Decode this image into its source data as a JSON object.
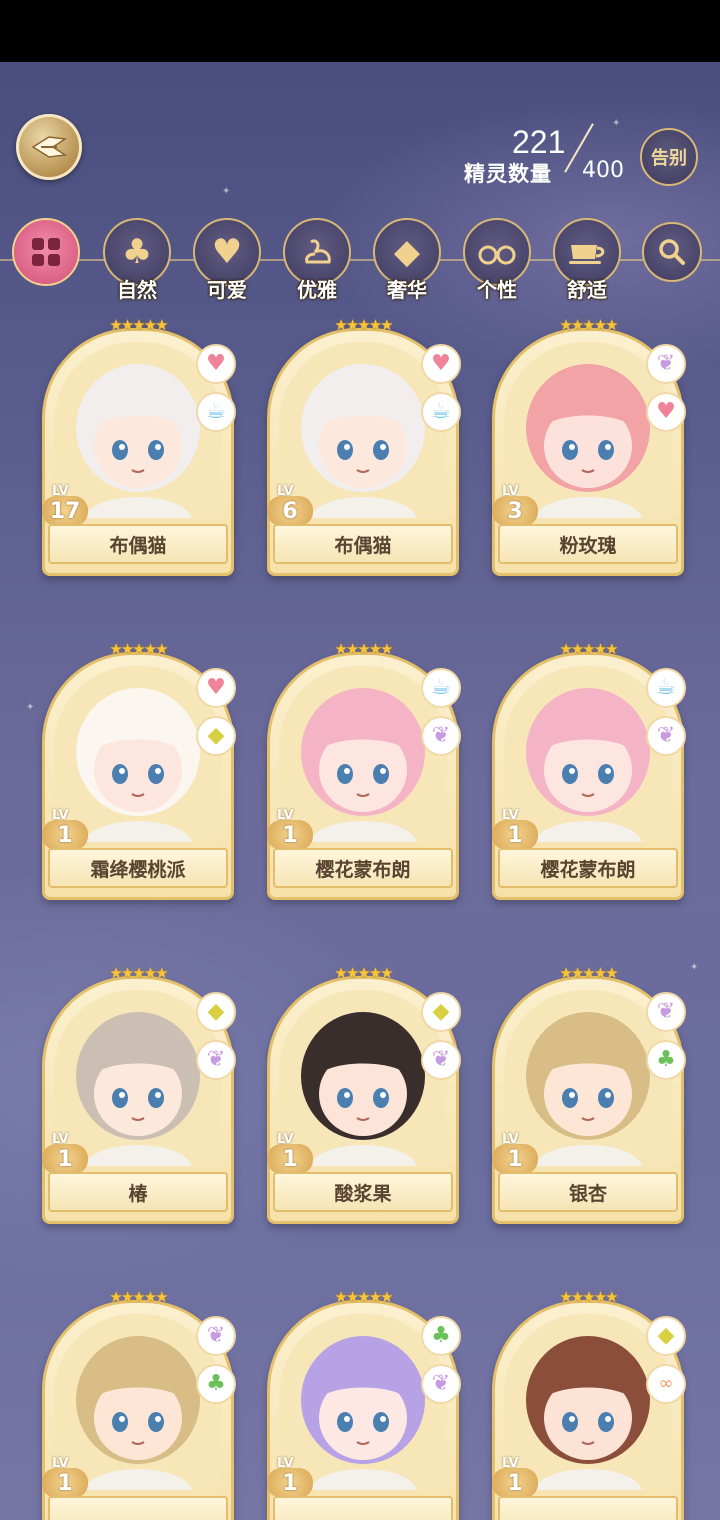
{
  "header": {
    "count_current": "221",
    "count_label": "精灵数量",
    "count_max": "400",
    "farewell_label": "告别"
  },
  "filters": [
    {
      "id": "all",
      "label": "",
      "icon": "grid-icon"
    },
    {
      "id": "natural",
      "label": "自然",
      "icon": "clover-icon"
    },
    {
      "id": "cute",
      "label": "可爱",
      "icon": "heart-icon"
    },
    {
      "id": "elegant",
      "label": "优雅",
      "icon": "swan-icon"
    },
    {
      "id": "luxury",
      "label": "奢华",
      "icon": "gem-icon"
    },
    {
      "id": "personality",
      "label": "个性",
      "icon": "glasses-icon"
    },
    {
      "id": "comfort",
      "label": "舒适",
      "icon": "teacup-icon"
    },
    {
      "id": "search",
      "label": "",
      "icon": "search-icon"
    }
  ],
  "lv_prefix": "LV",
  "cards": [
    {
      "name": "布偶猫",
      "level": "17",
      "badges": [
        "heart-icon",
        "teacup-icon"
      ],
      "hair": "#f2eeee",
      "skin": "#fde8de"
    },
    {
      "name": "布偶猫",
      "level": "6",
      "badges": [
        "heart-icon",
        "teacup-icon"
      ],
      "hair": "#f2eeee",
      "skin": "#fde8de"
    },
    {
      "name": "粉玫瑰",
      "level": "3",
      "badges": [
        "swan-icon",
        "heart-icon"
      ],
      "hair": "#f2a3a6",
      "skin": "#fde2dc"
    },
    {
      "name": "霜绛樱桃派",
      "level": "1",
      "badges": [
        "heart-icon",
        "gem-icon"
      ],
      "hair": "#fbf6ef",
      "skin": "#fde6de"
    },
    {
      "name": "樱花蒙布朗",
      "level": "1",
      "badges": [
        "teacup-icon",
        "swan-icon"
      ],
      "hair": "#f5b4c6",
      "skin": "#fde6e0"
    },
    {
      "name": "樱花蒙布朗",
      "level": "1",
      "badges": [
        "teacup-icon",
        "swan-icon"
      ],
      "hair": "#f5b4c6",
      "skin": "#fde6e0"
    },
    {
      "name": "椿",
      "level": "1",
      "badges": [
        "gem-icon",
        "swan-icon"
      ],
      "hair": "#cbbfb3",
      "skin": "#fde8dc"
    },
    {
      "name": "酸浆果",
      "level": "1",
      "badges": [
        "gem-icon",
        "swan-icon"
      ],
      "hair": "#3a2e2c",
      "skin": "#fde4d8"
    },
    {
      "name": "银杏",
      "level": "1",
      "badges": [
        "swan-icon",
        "clover-icon"
      ],
      "hair": "#d8be86",
      "skin": "#fde6d6"
    },
    {
      "name": "",
      "level": "1",
      "badges": [
        "swan-icon",
        "clover-icon"
      ],
      "hair": "#d8be86",
      "skin": "#fde6d6"
    },
    {
      "name": "",
      "level": "1",
      "badges": [
        "clover-icon",
        "swan-icon"
      ],
      "hair": "#b7a2e6",
      "skin": "#fde8e4"
    },
    {
      "name": "",
      "level": "1",
      "badges": [
        "gem-icon",
        "glasses-icon"
      ],
      "hair": "#8a4e3a",
      "skin": "#fde2d6"
    }
  ],
  "colors": {
    "accent_gold": "#e5c06a",
    "card_bg": "#fbf0cf",
    "background": "#5a5d8d"
  }
}
